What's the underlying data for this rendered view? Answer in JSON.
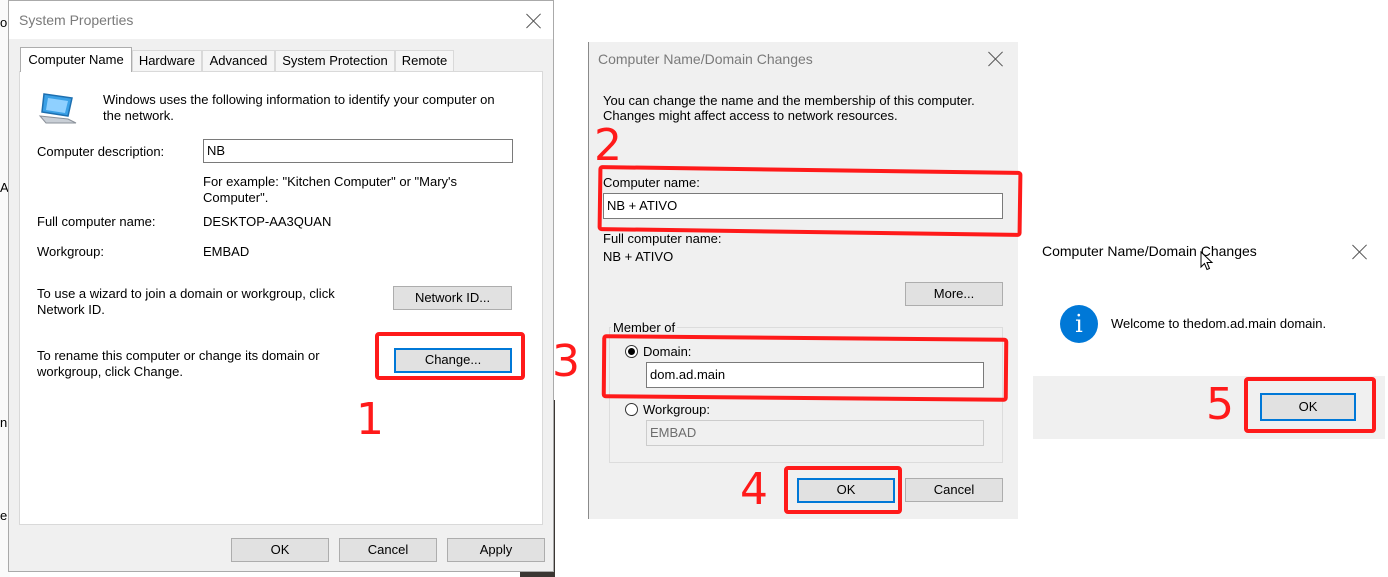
{
  "system_properties": {
    "title": "System Properties",
    "tabs": [
      "Computer Name",
      "Hardware",
      "Advanced",
      "System Protection",
      "Remote"
    ],
    "intro_text_1": "Windows uses the following information to identify your computer on",
    "intro_text_2": "the network.",
    "description_label": "Computer description:",
    "description_value": "NB",
    "example_text_1": "For example: \"Kitchen Computer\" or \"Mary's",
    "example_text_2": "Computer\".",
    "full_name_label": "Full computer name:",
    "full_name_value": "DESKTOP-AA3QUAN",
    "workgroup_label": "Workgroup:",
    "workgroup_value": "EMBAD",
    "network_id_text_1": "To use a wizard to join a domain or workgroup, click",
    "network_id_text_2": "Network ID.",
    "network_id_button": "Network ID...",
    "rename_text_1": "To rename this computer or change its domain or",
    "rename_text_2": "workgroup, click Change.",
    "change_button": "Change...",
    "ok_button": "OK",
    "cancel_button": "Cancel",
    "apply_button": "Apply"
  },
  "domain_changes": {
    "title": "Computer Name/Domain Changes",
    "info_1": "You can change the name and the membership of this computer.",
    "info_2": "Changes might affect access to network resources.",
    "computer_name_label": "Computer name:",
    "computer_name_value": "NB + ATIVO",
    "full_name_label": "Full computer name:",
    "full_name_value": "NB + ATIVO",
    "more_button": "More...",
    "member_of_label": "Member of",
    "domain_label": "Domain:",
    "domain_value": "dom.ad.main",
    "workgroup_label": "Workgroup:",
    "workgroup_value": "EMBAD",
    "ok_button": "OK",
    "cancel_button": "Cancel"
  },
  "welcome_dialog": {
    "title": "Computer Name/Domain Changes",
    "message_prefix": "Welcome to the",
    "message_domain": "dom.ad.main",
    "message_suffix": " domain.",
    "info_icon_glyph": "i",
    "ok_button": "OK"
  },
  "annotations": {
    "step_1": "1",
    "step_2": "2",
    "step_3": "3",
    "step_4": "4",
    "step_5": "5",
    "color": "#ff1a1a"
  },
  "background_fragments": [
    "or",
    "A",
    "n,",
    "en"
  ],
  "colors": {
    "dialog_bg": "#f0f0f0",
    "default_button_border": "#0078d7",
    "info_icon": "#0078d7",
    "annotation_red": "#ff1a1a"
  }
}
